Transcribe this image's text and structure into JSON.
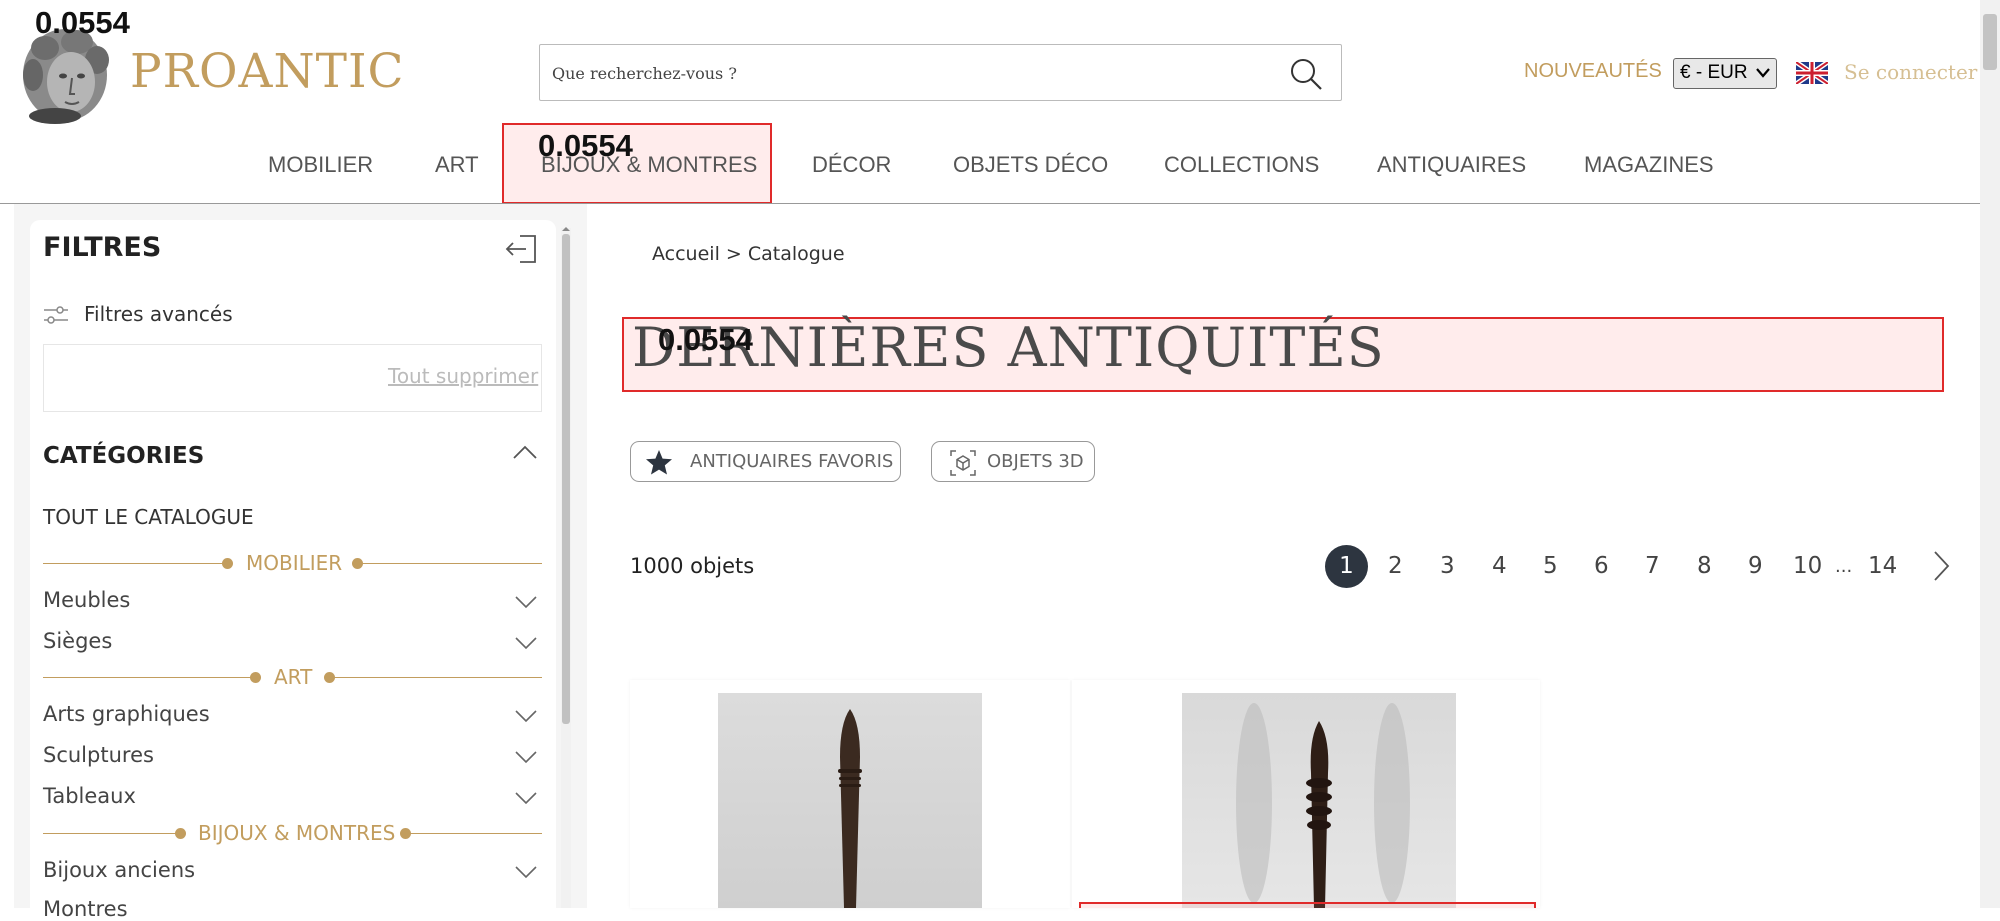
{
  "overlay": {
    "score": "0.0554"
  },
  "header": {
    "brand": "PROANTIC",
    "search_placeholder": "Que recherchez-vous ?",
    "nouveautes": "NOUVEAUTÉS",
    "currency": {
      "selected": "€ - EUR"
    },
    "login": "Se connecter"
  },
  "nav": {
    "items": [
      "MOBILIER",
      "ART",
      "BIJOUX & MONTRES",
      "DÉCOR",
      "OBJETS DÉCO",
      "COLLECTIONS",
      "ANTIQUAIRES",
      "MAGAZINES"
    ]
  },
  "sidebar": {
    "title": "FILTRES",
    "advanced": "Filtres avancés",
    "clear_all": "Tout supprimer",
    "categories_title": "CATÉGORIES",
    "all_catalog": "TOUT LE CATALOGUE",
    "groups": [
      {
        "label": "MOBILIER",
        "items": [
          "Meubles",
          "Sièges"
        ]
      },
      {
        "label": "ART",
        "items": [
          "Arts graphiques",
          "Sculptures",
          "Tableaux"
        ]
      },
      {
        "label": "BIJOUX & MONTRES",
        "items": [
          "Bijoux anciens",
          "Montres"
        ]
      }
    ]
  },
  "main": {
    "breadcrumb": "Accueil > Catalogue",
    "title": "DERNIÈRES ANTIQUITÉS",
    "filters": {
      "favorites": "ANTIQUAIRES FAVORIS",
      "objects3d": "OBJETS 3D"
    },
    "count": "1000 objets",
    "pagination": {
      "current": "1",
      "pages": [
        "2",
        "3",
        "4",
        "5",
        "6",
        "7",
        "8",
        "9",
        "10"
      ],
      "ellipsis": "...",
      "last": "14"
    }
  },
  "colors": {
    "accent": "#c29d5e",
    "highlight": "#e02a2a",
    "pagination_active": "#2d3540"
  },
  "icons": [
    "search-icon",
    "uk-flag-icon",
    "collapse-panel-icon",
    "filter-sliders-icon",
    "chevron-up-icon",
    "chevron-down-icon",
    "star-icon",
    "cube-3d-icon",
    "chevron-right-icon"
  ]
}
